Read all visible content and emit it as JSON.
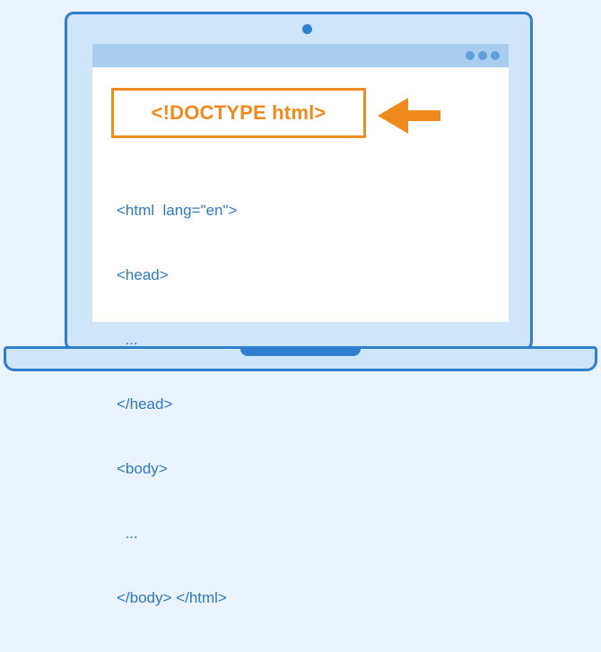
{
  "doctype": {
    "text": "<!DOCTYPE html>"
  },
  "code_lines": [
    "<html  lang=\"en\">",
    "<head>",
    "  ...",
    "</head>",
    "<body>",
    "  ...",
    "</body> </html>"
  ],
  "colors": {
    "background": "#eaf3fc",
    "laptop_outline": "#2e7fce",
    "laptop_fill": "#cfe5fa",
    "titlebar": "#a9cdee",
    "accent_orange": "#f08a1c",
    "code_blue": "#2f78c4"
  },
  "icons": [
    "camera-icon",
    "window-dots-icon",
    "arrow-left-icon"
  ]
}
